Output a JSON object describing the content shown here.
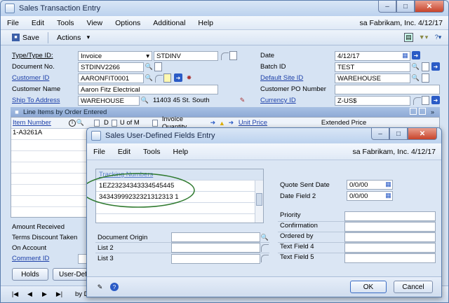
{
  "main": {
    "title": "Sales Transaction Entry",
    "menu": [
      "File",
      "Edit",
      "Tools",
      "View",
      "Options",
      "Additional",
      "Help"
    ],
    "user_info": "sa  Fabrikam, Inc.  4/12/17",
    "toolbar": {
      "save": "Save",
      "actions": "Actions"
    },
    "fields": {
      "type_label": "Type/Type ID:",
      "type_value": "Invoice",
      "type_id_value": "STDINV",
      "docno_label": "Document No.",
      "docno_value": "STDINV2266",
      "customer_id_label": "Customer ID",
      "customer_id_value": "AARONFIT0001",
      "customer_name_label": "Customer Name",
      "customer_name_value": "Aaron Fitz Electrical",
      "ship_to_label": "Ship To Address",
      "ship_to_value": "WAREHOUSE",
      "ship_to_address": "11403 45 St. South",
      "date_label": "Date",
      "date_value": "4/12/17",
      "batch_label": "Batch ID",
      "batch_value": "TEST",
      "site_label": "Default Site ID",
      "site_value": "WAREHOUSE",
      "po_label": "Customer PO Number",
      "currency_label": "Currency ID",
      "currency_value": "Z-US$"
    },
    "grid": {
      "header": "Line Items by Order Entered",
      "col_item": "Item Number",
      "col_d": "D",
      "col_uofm": "U of M",
      "col_qty": "Invoice Quantity",
      "col_price": "Unit Price",
      "col_ext": "Extended Price",
      "first_item": "1-A3261A"
    },
    "totals": {
      "amount_received": "Amount Received",
      "terms_discount": "Terms Discount Taken",
      "on_account": "On Account",
      "comment_id": "Comment ID"
    },
    "buttons": {
      "holds": "Holds",
      "user_defined": "User-Defi"
    },
    "nav": {
      "sort": "by Docum"
    }
  },
  "dialog": {
    "title": "Sales User-Defined Fields Entry",
    "menu": [
      "File",
      "Edit",
      "Tools",
      "Help"
    ],
    "user_info": "sa  Fabrikam, Inc.  4/12/17",
    "tracking_header": "Tracking Numbers",
    "tracking": [
      "1EZ23234343334545445",
      "34343999232321312313 1"
    ],
    "quote_sent_label": "Quote Sent Date",
    "quote_sent_value": "0/0/00",
    "date2_label": "Date Field 2",
    "date2_value": "0/0/00",
    "priority_label": "Priority",
    "confirmation_label": "Confirmation",
    "ordered_by_label": "Ordered by",
    "text4_label": "Text Field 4",
    "text5_label": "Text Field 5",
    "doc_origin_label": "Document Origin",
    "list2_label": "List 2",
    "list3_label": "List 3",
    "ok": "OK",
    "cancel": "Cancel"
  }
}
